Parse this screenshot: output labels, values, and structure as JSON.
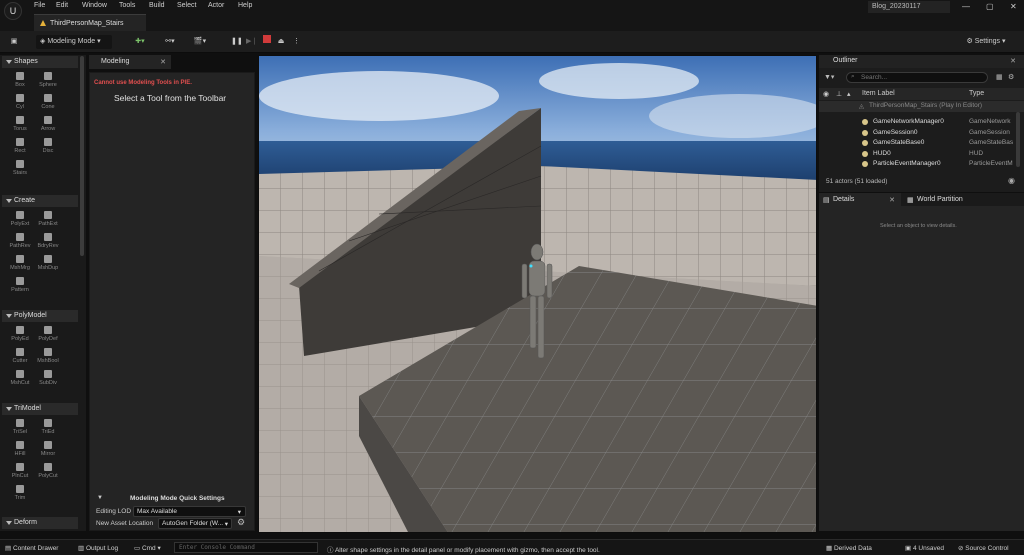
{
  "titlebar": {
    "menus": [
      "File",
      "Edit",
      "Window",
      "Tools",
      "Build",
      "Select",
      "Actor",
      "Help"
    ],
    "doc_tab": "ThirdPersonMap_Stairs",
    "project": "Blog_20230117"
  },
  "toolbar": {
    "mode": "Modeling Mode",
    "settings": "Settings"
  },
  "left_panel": {
    "sections": [
      {
        "title": "Shapes",
        "tools": [
          "Box",
          "Sphere",
          "Cyl",
          "Cone",
          "Torus",
          "Arrow",
          "Rect",
          "Disc",
          "Stairs"
        ]
      },
      {
        "title": "Create",
        "tools": [
          "PolyExt",
          "PathExt",
          "PathRev",
          "BdryRev",
          "MshMrg",
          "MshDup",
          "Pattern"
        ]
      },
      {
        "title": "PolyModel",
        "tools": [
          "PolyEd",
          "PolyDef",
          "Cutter",
          "MshBool",
          "MshCut",
          "SubDiv"
        ]
      },
      {
        "title": "TriModel",
        "tools": [
          "TriSel",
          "TriEd",
          "HFill",
          "Mirror",
          "PlnCut",
          "PolyCut",
          "Trim"
        ]
      },
      {
        "title": "Deform",
        "tools": []
      }
    ]
  },
  "modeling": {
    "tab": "Modeling",
    "warning": "Cannot use Modeling Tools in PIE.",
    "prompt": "Select a Tool from the Toolbar",
    "quick_settings": "Modeling Mode Quick Settings",
    "editing_lod_label": "Editing LOD",
    "editing_lod_value": "Max Available",
    "asset_location_label": "New Asset Location",
    "asset_location_value": "AutoGen Folder (W..."
  },
  "outliner": {
    "tab": "Outliner",
    "search_placeholder": "Search...",
    "col_label": "Item Label",
    "col_type": "Type",
    "root": "ThirdPersonMap_Stairs (Play In Editor)",
    "rows": [
      {
        "name": "GameNetworkManager0",
        "type": "GameNetwork"
      },
      {
        "name": "GameSession0",
        "type": "GameSession"
      },
      {
        "name": "GameStateBase0",
        "type": "GameStateBas"
      },
      {
        "name": "HUD0",
        "type": "HUD"
      },
      {
        "name": "ParticleEventManager0",
        "type": "ParticleEventM"
      }
    ],
    "actor_count": "51 actors (51 loaded)"
  },
  "details": {
    "tab_details": "Details",
    "tab_world": "World Partition",
    "empty_msg": "Select an object to view details."
  },
  "statusbar": {
    "content_drawer": "Content Drawer",
    "output_log": "Output Log",
    "cmd": "Cmd",
    "console_placeholder": "Enter Console Command",
    "hint": "Alter shape settings in the detail panel or modify placement with gizmo, then accept the tool.",
    "derived_data": "Derived Data",
    "unsaved": "4 Unsaved",
    "source_control": "Source Control"
  },
  "colors": {
    "accent": "#e6b23a",
    "warn": "#e14f4f",
    "stop": "#d13b3b",
    "bg": "#1a1a1a"
  }
}
